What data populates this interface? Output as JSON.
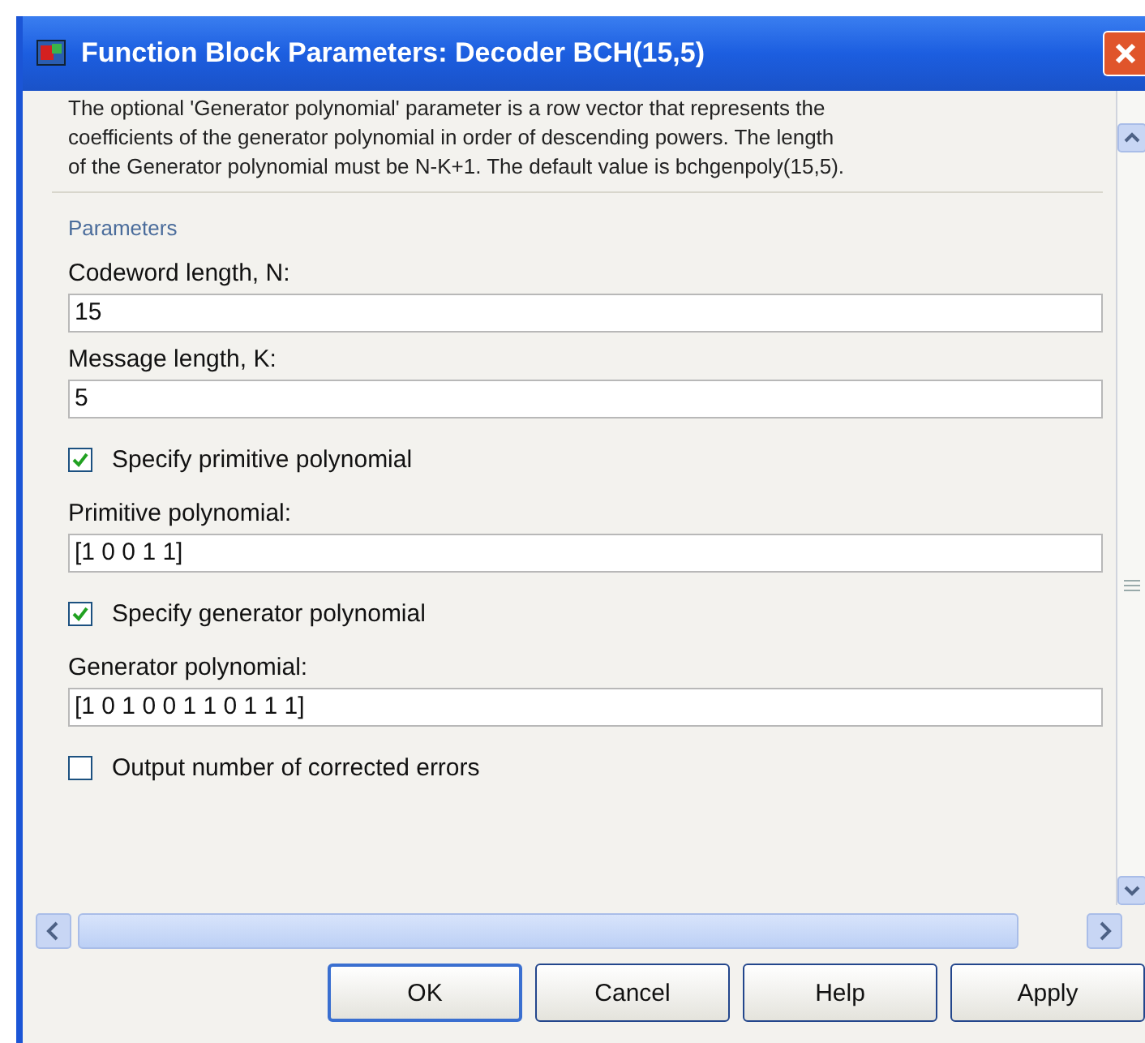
{
  "window": {
    "title": "Function Block Parameters: Decoder BCH(15,5)"
  },
  "description": [
    "The optional 'Generator polynomial' parameter is a row vector that represents the",
    "coefficients of the generator polynomial in order of descending powers.  The length",
    "of the Generator polynomial must be N-K+1.  The default value is bchgenpoly(15,5)."
  ],
  "parameters": {
    "title": "Parameters",
    "items": [
      {
        "kind": "field",
        "label": "Codeword length, N:",
        "value": "15"
      },
      {
        "kind": "field",
        "label": "Message length, K:",
        "value": "5"
      },
      {
        "kind": "checkbox",
        "label": "Specify primitive polynomial",
        "checked": true
      },
      {
        "kind": "field",
        "label": "Primitive polynomial:",
        "value": "[1 0 0 1 1]"
      },
      {
        "kind": "checkbox",
        "label": "Specify generator polynomial",
        "checked": true
      },
      {
        "kind": "field",
        "label": "Generator polynomial:",
        "value": "[1 0 1 0 0 1 1 0 1 1 1]"
      },
      {
        "kind": "checkbox",
        "label": "Output number of corrected errors",
        "checked": false
      }
    ]
  },
  "buttons": [
    {
      "label": "OK",
      "default": true
    },
    {
      "label": "Cancel",
      "default": false
    },
    {
      "label": "Help",
      "default": false
    },
    {
      "label": "Apply",
      "default": false
    }
  ]
}
